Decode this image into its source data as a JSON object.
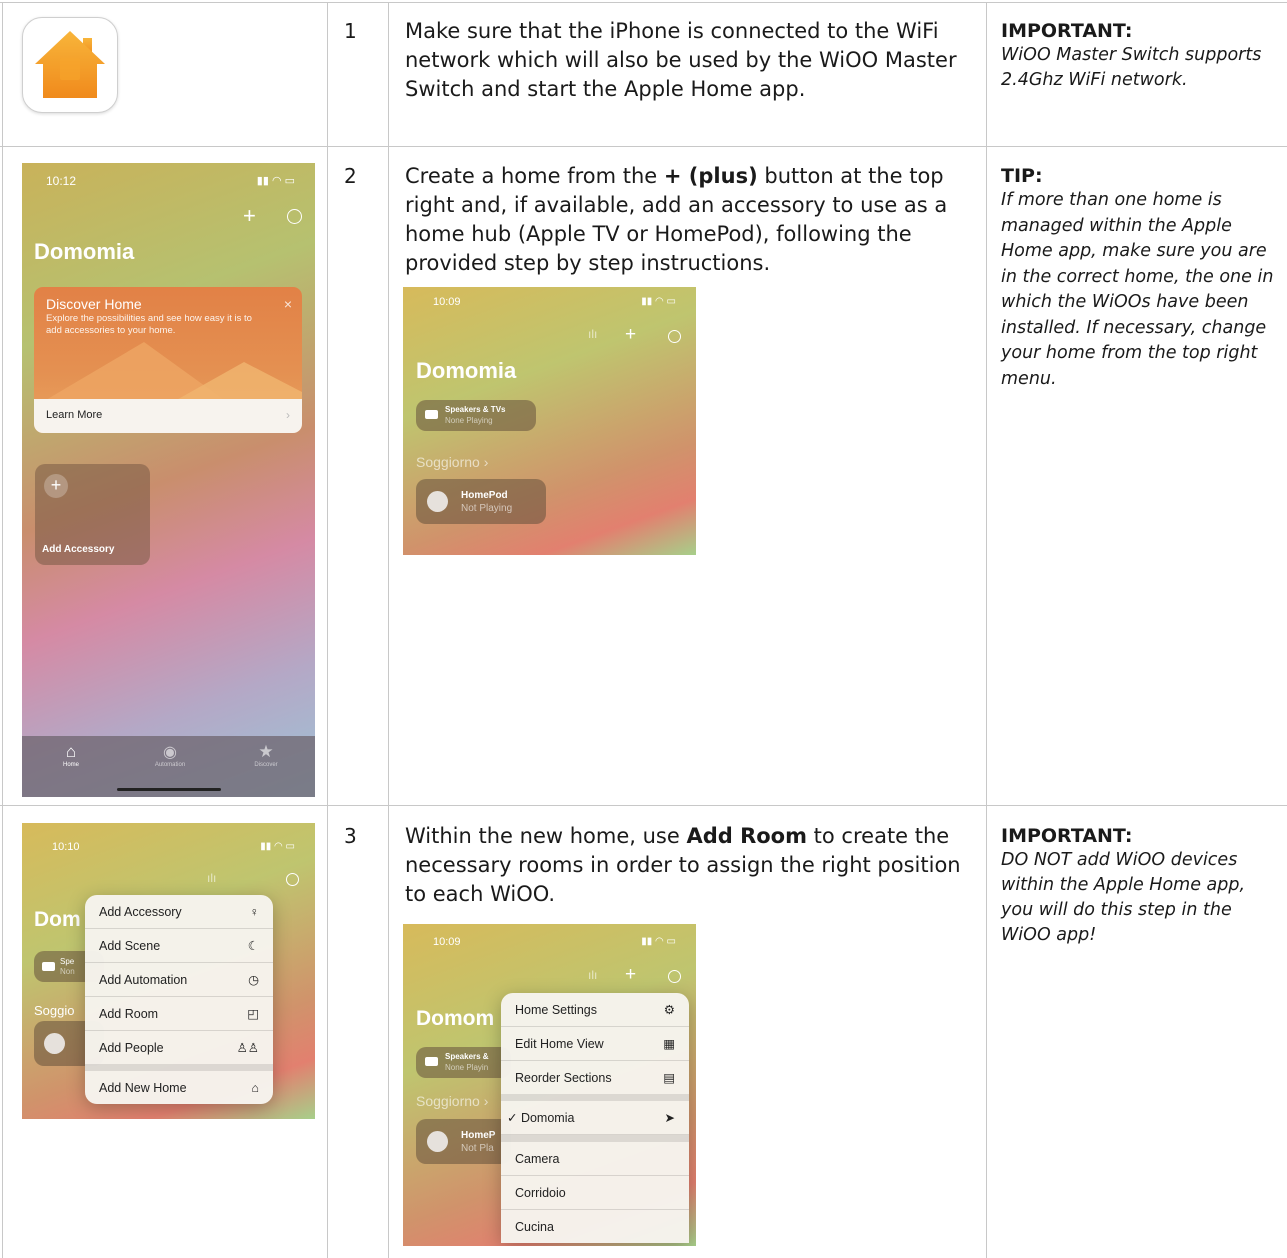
{
  "rows": [
    {
      "step": "1",
      "text_parts": [
        "Make sure that the iPhone is connected to the WiFi network which will also be used by the WiOO Master Switch and start the Apple Home app."
      ],
      "note_title": "IMPORTANT:",
      "note_body": "WiOO Master Switch supports 2.4Ghz WiFi network."
    },
    {
      "step": "2",
      "text_before": "Create a home from the ",
      "text_bold": "+ (plus)",
      "text_after": " button at the top right and, if available, add an accessory to use as a home hub (Apple TV or HomePod), following the provided step by step instructions.",
      "note_title": "TIP:",
      "note_body": "If more than one home is managed within the Apple Home app, make sure you are in the correct home, the one in which the WiOOs have been installed. If necessary, change your home from the top right menu."
    },
    {
      "step": "3",
      "text_before": "Within the new home, use ",
      "text_bold": "Add Room",
      "text_after": " to create the necessary rooms in order to assign the right position to each WiOO.",
      "note_title": "IMPORTANT:",
      "note_body": "DO NOT add WiOO devices within the Apple Home app, you will do this step in the WiOO app!"
    }
  ],
  "shot_home": {
    "time": "10:12",
    "home_name": "Domomia",
    "banner_title": "Discover Home",
    "banner_text": "Explore the possibilities and see how easy it is to add accessories to your home.",
    "learn_more": "Learn More",
    "add_accessory": "Add Accessory",
    "tabs": [
      "Home",
      "Automation",
      "Discover"
    ]
  },
  "shot_hub": {
    "time": "10:09",
    "home_name": "Domomia",
    "tile1_title": "Speakers & TVs",
    "tile1_sub": "None Playing",
    "room": "Soggiorno",
    "tile2_title": "HomePod",
    "tile2_sub": "Not Playing"
  },
  "shot_add_menu": {
    "time": "10:10",
    "home_partial": "Dom",
    "room_partial": "Soggio",
    "items": [
      "Add Accessory",
      "Add Scene",
      "Add Automation",
      "Add Room",
      "Add People"
    ],
    "last_item": "Add New Home",
    "partial_tile": "Spe",
    "partial_tile_sub": "Non"
  },
  "shot_home_menu": {
    "time": "10:09",
    "home_partial": "Domom",
    "tile1_title": "Speakers &",
    "tile1_sub": "None Playin",
    "room": "Soggiorno",
    "tile2_title": "HomeP",
    "tile2_sub": "Not Pla",
    "items": [
      "Home Settings",
      "Edit Home View",
      "Reorder Sections"
    ],
    "current_home": "Domomia",
    "rooms": [
      "Camera",
      "Corridoio",
      "Cucina"
    ]
  }
}
